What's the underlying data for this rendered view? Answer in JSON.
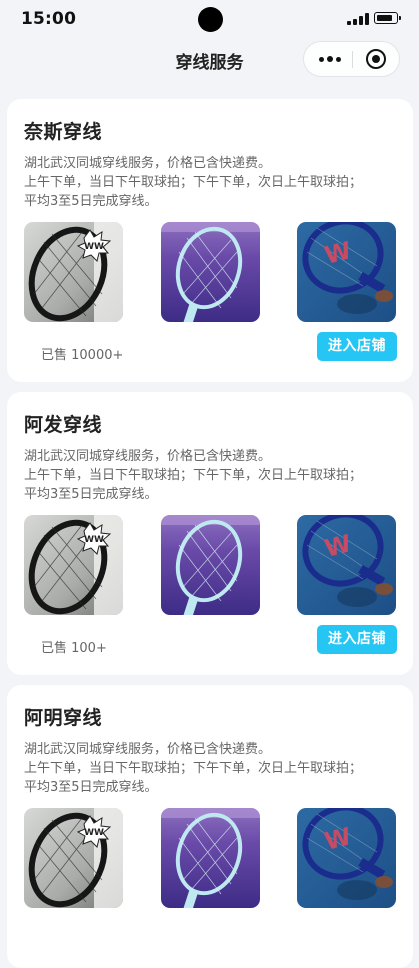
{
  "status_bar": {
    "time": "15:00",
    "battery_level": 0.85
  },
  "nav": {
    "title": "穿线服务",
    "more_icon": "more-dots-icon",
    "close_icon": "target-close-icon"
  },
  "shops": [
    {
      "name": "奈斯穿线",
      "desc_lines": [
        "湖北武汉同城穿线服务，价格已含快递费。",
        "上午下单，当日下午取球拍；下午下单，次日上午取球拍；",
        "平均3至5日完成穿线。"
      ],
      "sold": "已售 10000+",
      "enter_label": "进入店铺",
      "photos": [
        "racket-wow-photo",
        "racket-purple-photo",
        "racket-wilson-photo"
      ]
    },
    {
      "name": "阿发穿线",
      "desc_lines": [
        "湖北武汉同城穿线服务，价格已含快递费。",
        "上午下单，当日下午取球拍；下午下单，次日上午取球拍；",
        "平均3至5日完成穿线。"
      ],
      "sold": "已售 100+",
      "enter_label": "进入店铺",
      "photos": [
        "racket-wow-photo",
        "racket-purple-photo",
        "racket-wilson-photo"
      ]
    },
    {
      "name": "阿明穿线",
      "desc_lines": [
        "湖北武汉同城穿线服务，价格已含快递费。",
        "上午下单，当日下午取球拍；下午下单，次日上午取球拍；",
        "平均3至5日完成穿线。"
      ],
      "sold": "",
      "enter_label": "",
      "photos": [
        "racket-wow-photo",
        "racket-purple-photo",
        "racket-wilson-photo"
      ]
    }
  ],
  "colors": {
    "page_background": "#f2f4f7",
    "card_background": "#ffffff",
    "accent_button": "#25c6f4",
    "title_text": "#222222",
    "desc_text": "#666666"
  }
}
